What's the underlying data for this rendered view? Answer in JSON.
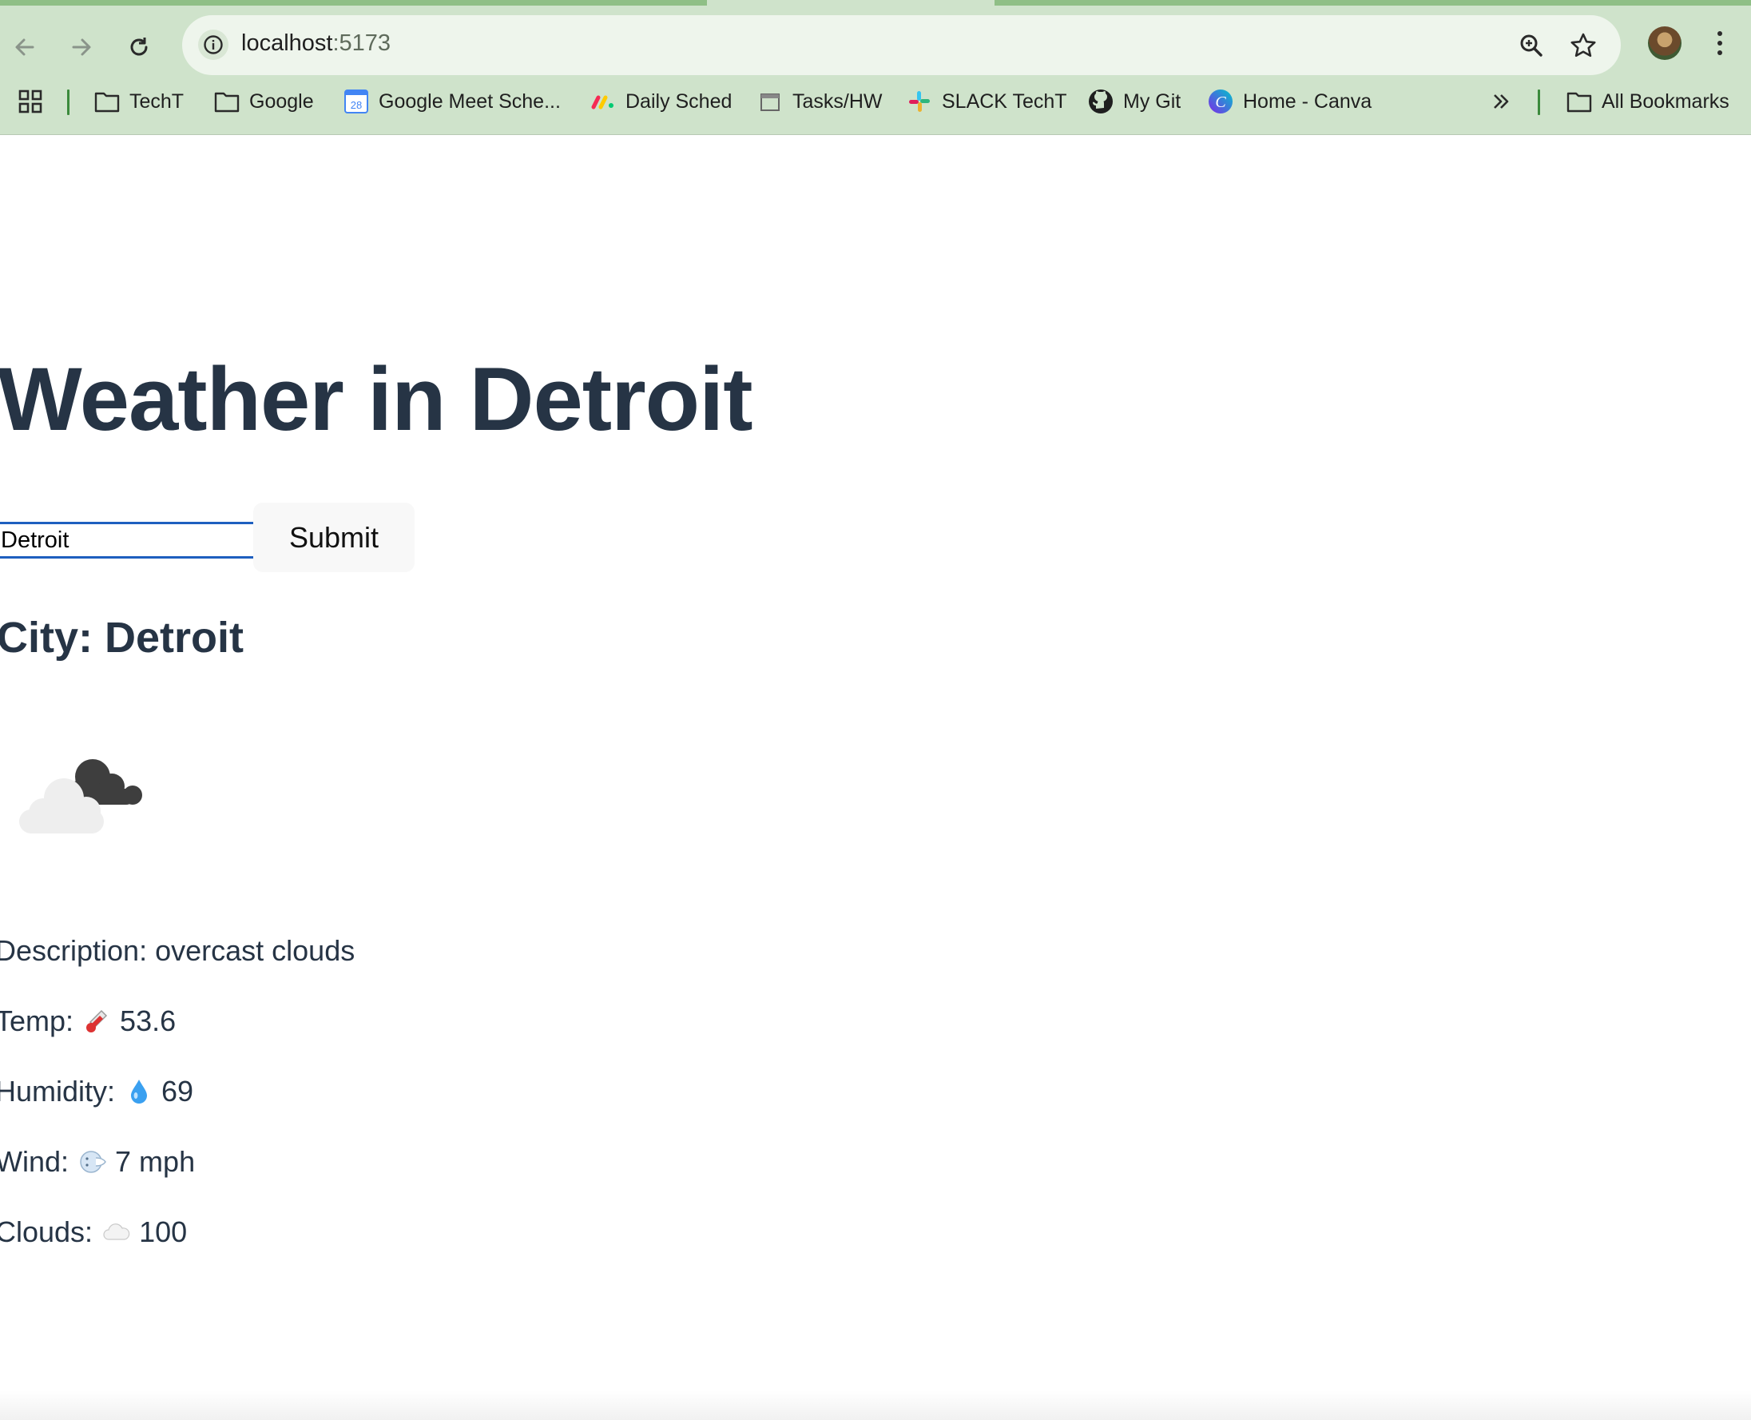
{
  "browser": {
    "url_host": "localhost",
    "url_port": ":5173",
    "bookmarks": [
      {
        "label": "TechT",
        "icon": "folder-icon"
      },
      {
        "label": "Google",
        "icon": "folder-icon"
      },
      {
        "label": "Google Meet Sche...",
        "icon": "google-calendar-icon"
      },
      {
        "label": "Daily Sched",
        "icon": "monday-icon"
      },
      {
        "label": "Tasks/HW",
        "icon": "calendar-icon"
      },
      {
        "label": "SLACK TechT",
        "icon": "slack-icon"
      },
      {
        "label": "My Git",
        "icon": "github-icon"
      },
      {
        "label": "Home - Canva",
        "icon": "canva-icon"
      }
    ],
    "all_bookmarks_label": "All Bookmarks"
  },
  "page": {
    "title": "Weather in Detroit",
    "search": {
      "value": "Detroit",
      "submit_label": "Submit"
    },
    "city_heading": "City: Detroit",
    "weather_icon": "overcast-clouds-icon",
    "stats": [
      {
        "label": "Description:",
        "emoji": "",
        "value": "overcast clouds"
      },
      {
        "label": "Temp:",
        "emoji": "thermometer-icon",
        "value": "53.6"
      },
      {
        "label": "Humidity:",
        "emoji": "droplet-icon",
        "value": "69"
      },
      {
        "label": "Wind:",
        "emoji": "wind-face-icon",
        "value": "7 mph"
      },
      {
        "label": "Clouds:",
        "emoji": "cloud-icon",
        "value": "100"
      }
    ]
  },
  "colors": {
    "chrome_bg": "#cfe3cb",
    "omnibox_bg": "#eef5ec",
    "text_heading": "#263445",
    "focus_ring": "#1e5fbf"
  }
}
